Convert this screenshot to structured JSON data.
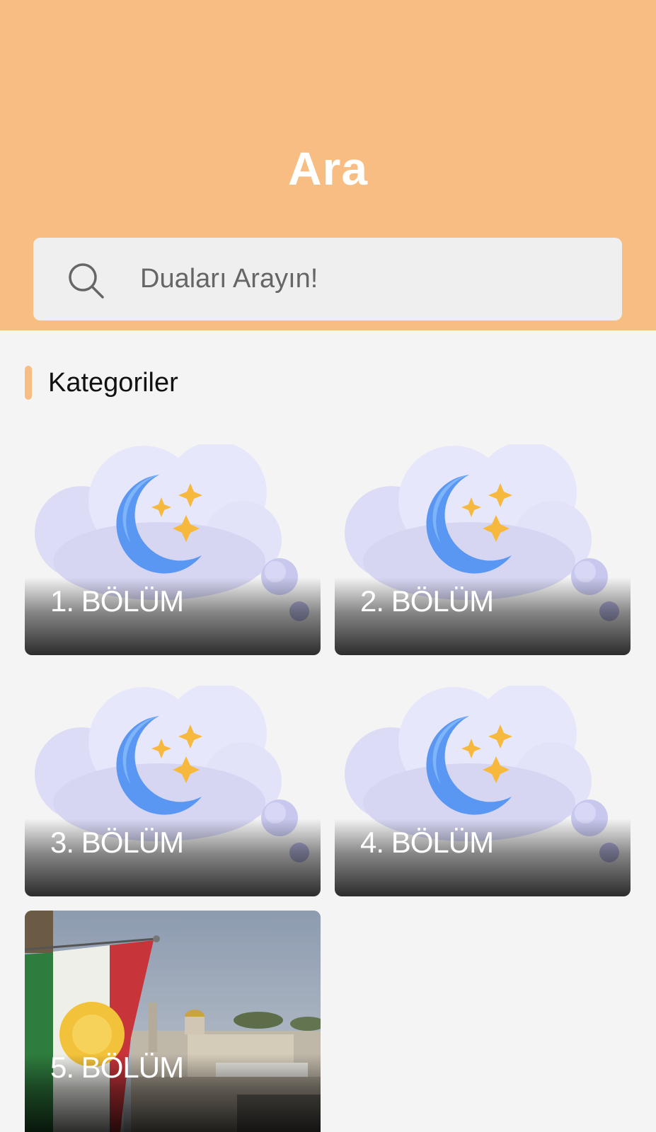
{
  "header": {
    "title": "Ara"
  },
  "search": {
    "placeholder": "Duaları Arayın!",
    "icon": "search-icon"
  },
  "section": {
    "title": "Kategoriler"
  },
  "categories": [
    {
      "label": "1. BÖLÜM",
      "image": "moon-stars-cloud-icon"
    },
    {
      "label": "2. BÖLÜM",
      "image": "moon-stars-cloud-icon"
    },
    {
      "label": "3. BÖLÜM",
      "image": "moon-stars-cloud-icon"
    },
    {
      "label": "4. BÖLÜM",
      "image": "moon-stars-cloud-icon"
    },
    {
      "label": "5. BÖLÜM",
      "image": "flag-city-photo"
    }
  ],
  "colors": {
    "accent": "#f8bd82",
    "background": "#f4f4f4",
    "search_bg": "#efefef"
  }
}
